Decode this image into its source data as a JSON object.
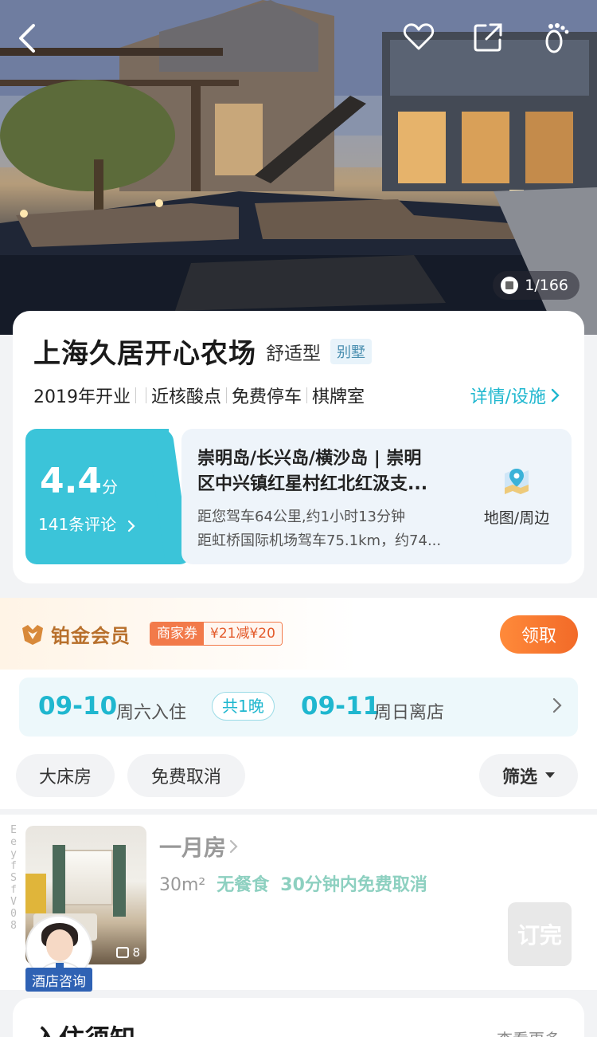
{
  "hero": {
    "photo_count": "1/166",
    "icons": [
      "back-arrow-icon",
      "heart-icon",
      "share-icon",
      "footprint-icon"
    ]
  },
  "hotel": {
    "name": "上海久居开心农场",
    "type": "舒适型",
    "tag": "别墅",
    "facts": [
      "2019年开业",
      "近核酸点",
      "免费停车",
      "棋牌室"
    ],
    "detail_link": "详情/设施"
  },
  "rating": {
    "score": "4.4",
    "unit": "分",
    "reviews": "141条评论"
  },
  "location": {
    "address_line1": "崇明岛/长兴岛/横沙岛 | 崇明",
    "address_line2": "区中兴镇红星村红北红汲支...",
    "distance_1": "距您驾车64公里,约1小时13分钟",
    "distance_2": "距虹桥国际机场驾车75.1km，约74...",
    "map_label": "地图/周边"
  },
  "member": {
    "level": "铂金会员",
    "coupon_type": "商家券",
    "coupon_value": "¥21减¥20",
    "claim_label": "领取"
  },
  "dates": {
    "checkin_date": "09-10",
    "checkin_label": "周六入住",
    "nights": "共1晚",
    "checkout_date": "09-11",
    "checkout_label": "周日离店"
  },
  "filters": {
    "chips": [
      "大床房",
      "免费取消"
    ],
    "filter_label": "筛选"
  },
  "room": {
    "side_code": "EeyfSfV08",
    "name": "一月房",
    "size": "30m²",
    "meal": "无餐食",
    "cancel": "30分钟内免费取消",
    "image_count": "8",
    "consult_label": "酒店咨询",
    "book_label": "订完"
  },
  "notice": {
    "title": "入住须知",
    "more": "查看更多"
  },
  "colors": {
    "accent": "#1fb7cf",
    "score_bg": "#3bc4d9",
    "member_gold": "#b8702c",
    "claim_orange": "#f26a28",
    "consult_blue": "#2f62b4"
  }
}
